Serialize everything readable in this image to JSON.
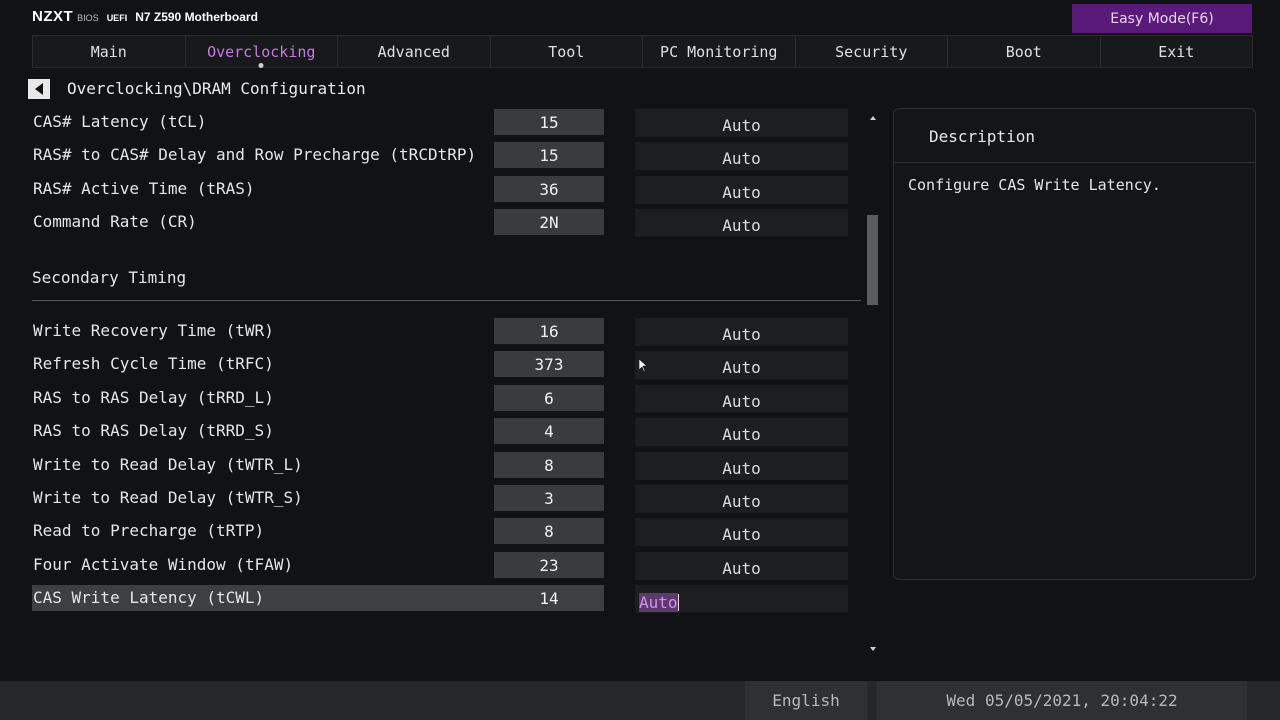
{
  "header": {
    "logo": "NZXT",
    "bios": "BIOS",
    "uefi": "UEFI",
    "board": "N7 Z590 Motherboard",
    "easy_mode": "Easy Mode(F6)"
  },
  "tabs": [
    {
      "label": "Main"
    },
    {
      "label": "Overclocking",
      "active": true
    },
    {
      "label": "Advanced"
    },
    {
      "label": "Tool"
    },
    {
      "label": "PC Monitoring"
    },
    {
      "label": "Security"
    },
    {
      "label": "Boot"
    },
    {
      "label": "Exit"
    }
  ],
  "breadcrumb": "Overclocking\\DRAM Configuration",
  "primary": [
    {
      "label": "CAS# Latency (tCL)",
      "value": "15",
      "mode": "Auto"
    },
    {
      "label": "RAS# to CAS# Delay and Row Precharge (tRCDtRP)",
      "value": "15",
      "mode": "Auto"
    },
    {
      "label": "RAS# Active Time (tRAS)",
      "value": "36",
      "mode": "Auto"
    },
    {
      "label": "Command Rate (CR)",
      "value": "2N",
      "mode": "Auto"
    }
  ],
  "secondary_title": "Secondary Timing",
  "secondary": [
    {
      "label": "Write Recovery Time (tWR)",
      "value": "16",
      "mode": "Auto"
    },
    {
      "label": "Refresh Cycle Time (tRFC)",
      "value": "373",
      "mode": "Auto"
    },
    {
      "label": "RAS to RAS Delay (tRRD_L)",
      "value": "6",
      "mode": "Auto"
    },
    {
      "label": "RAS to RAS Delay (tRRD_S)",
      "value": "4",
      "mode": "Auto"
    },
    {
      "label": "Write to Read Delay (tWTR_L)",
      "value": "8",
      "mode": "Auto"
    },
    {
      "label": "Write to Read Delay (tWTR_S)",
      "value": "3",
      "mode": "Auto"
    },
    {
      "label": "Read to Precharge (tRTP)",
      "value": "8",
      "mode": "Auto"
    },
    {
      "label": "Four Activate Window (tFAW)",
      "value": "23",
      "mode": "Auto"
    },
    {
      "label": "CAS Write Latency (tCWL)",
      "value": "14",
      "mode": "Auto",
      "selected": true
    }
  ],
  "description": {
    "title": "Description",
    "text": "Configure CAS Write Latency."
  },
  "footer": {
    "language": "English",
    "datetime": "Wed 05/05/2021, 20:04:22"
  },
  "colors": {
    "accent": "#c77adf",
    "easy_mode_bg": "#5a1a7a",
    "background": "#111214"
  }
}
